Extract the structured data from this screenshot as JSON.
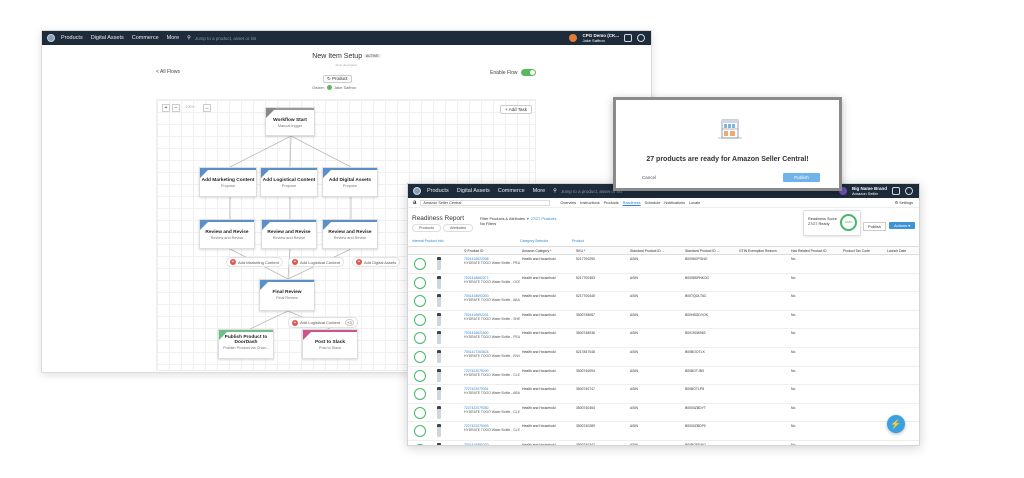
{
  "topnav": {
    "items": [
      "Products",
      "Digital Assets",
      "Commerce",
      "More"
    ],
    "search_placeholder": "Jump to a product, asset or list",
    "account_name": "CPG Demo (CK...",
    "account_user": "Jake Saffron"
  },
  "workflow": {
    "title": "New Item Setup",
    "title_badge": "ACTIVE",
    "subtitle": "Flow description",
    "back_link": "< All Flows",
    "enable_label": "Enable Flow",
    "product_label": "Product",
    "owner_label": "Owner:",
    "owner_name": "Jake Saffron",
    "add_task": "+ Add Task",
    "zoom_label": "100%",
    "nodes": [
      {
        "title": "Workflow Start",
        "sub": "Manual trigger"
      },
      {
        "title": "Add Marketing Content",
        "sub": "Propose"
      },
      {
        "title": "Add Logistical Content",
        "sub": "Propose"
      },
      {
        "title": "Add Digital Assets",
        "sub": "Propose"
      },
      {
        "title": "Review and Revise",
        "sub": "Review and Revise"
      },
      {
        "title": "Review and Revise",
        "sub": "Review and Revise"
      },
      {
        "title": "Review and Revise",
        "sub": "Review and Revise"
      },
      {
        "title": "Final Review",
        "sub": "Final Review"
      },
      {
        "title": "Publish Product to DoorDash",
        "sub": "Publish Product via Chan..."
      },
      {
        "title": "Post to Slack",
        "sub": "Post to Slack"
      }
    ],
    "add_pills": [
      "Add Marketing Content",
      "Add Logistical Content",
      "Add Digital Assets",
      "Add Logistical Content"
    ],
    "pill_count": "+3"
  },
  "modal": {
    "title": "27 products are ready for Amazon Seller Central!",
    "cancel": "Cancel",
    "publish": "Publish"
  },
  "report": {
    "topnav_items": [
      "Products",
      "Digital Assets",
      "Commerce",
      "More"
    ],
    "search_placeholder": "Jump to a product, asset or list",
    "brand": "Big Name Brand",
    "brand_sub": "Amazon Seller",
    "store": "Amazon Seller Central",
    "tabs": [
      "Overview",
      "Instructions",
      "Products",
      "Readiness",
      "Schedule",
      "Notifications",
      "Locale"
    ],
    "active_tab": "Readiness",
    "settings": "Settings",
    "title": "Readiness Report",
    "filter_label": "Filter Products & Attributes",
    "filter_link": "27/27 Products",
    "filter_none": "No Filters",
    "subtabs": [
      "Products",
      "Attributes"
    ],
    "score_label": "Readiness Score",
    "score_value": "27/27 Ready",
    "score_ring": "100%",
    "publish_btn": "Publish",
    "actions_btn": "Actions",
    "groups": [
      "Internal Product Info",
      "Category Selector",
      "Product"
    ],
    "columns": [
      "",
      "",
      "Product ID",
      "Amazon Category *",
      "SKU *",
      "Standard Product ID ...",
      "Standard Product ID ...",
      "GTIN Exemption Reason",
      "Has Related Product ID",
      "Product Tax Code",
      "Launch Date"
    ],
    "rows": [
      {
        "id": "7001416623308",
        "desc": "HYDRATE TOGO Water Bottle - PEARL WHITE 500ml, Bamboo...",
        "cat": "Health and Household",
        "sku": "5217700290",
        "std": "ASIN",
        "asin": "B0098OPGNO",
        "rel": "No"
      },
      {
        "id": "7001418682372",
        "desc": "HYDRATE TOGO Water Bottle - OCEAN BLUE 500ml, Bamboo...",
        "cat": "Health and Household",
        "sku": "5217700353",
        "std": "ASIN",
        "asin": "B0098SPNKOC",
        "rel": "No"
      },
      {
        "id": "7001418693300",
        "desc": "HYDRATE TOGO Water Bottle - ABALONE GRAY 500ml, Bam...",
        "cat": "Health and Household",
        "sku": "5217700445",
        "std": "ASIN",
        "asin": "B00TQOLT6C",
        "rel": "No"
      },
      {
        "id": "7001416692201",
        "desc": "HYDRATE TOGO Water Bottle - SHELL PINK 500ml Bamboo",
        "cat": "Health and Household",
        "sku": "3500748087",
        "std": "ASIN",
        "asin": "B00HBGDYOK",
        "rel": "No"
      },
      {
        "id": "7001416621500",
        "desc": "HYDRATE TOGO Water Bottle - PEARL WHITE 750ml, Bamboo...",
        "cat": "Health and Household",
        "sku": "3500748036",
        "std": "ASIN",
        "asin": "B00190W063",
        "rel": "No"
      },
      {
        "id": "7001417263624",
        "desc": "HYDRATE TOGO Water Bottle - ENVY SEA BLUE 750ml, Bam...",
        "cat": "Health and Household",
        "sku": "5217847048",
        "std": "ASIN",
        "asin": "B00BOOTLX",
        "rel": "No"
      },
      {
        "id": "7227422079200",
        "desc": "HYDRATE TOGO Water Bottle - CLEAR 500ml, Plastic Screw...",
        "cat": "Health and Household",
        "sku": "3500740094",
        "std": "ASIN",
        "asin": "B00BOTJB3",
        "rel": "No"
      },
      {
        "id": "7227422079301",
        "desc": "HYDRATE TOGO Water Bottle - ABALONE GRAY 750ml, Bam...",
        "cat": "Health and Household",
        "sku": "3500740747",
        "std": "ASIN",
        "asin": "B00BOTLP8",
        "rel": "No"
      },
      {
        "id": "7227422079352",
        "desc": "HYDRATE TOGO Water Bottle - CLEAR 750ml, Plastic Screw To...",
        "cat": "Health and Household",
        "sku": "3500740454",
        "std": "ASIN",
        "asin": "B0000ZBDYT",
        "rel": "No"
      },
      {
        "id": "7227422079403",
        "desc": "HYDRATE TOGO Water Bottle - CLEAR 750ml, Plastic Screw...",
        "cat": "Health and Household",
        "sku": "3500740289",
        "std": "ASIN",
        "asin": "B0000ZBDP0",
        "rel": "No"
      },
      {
        "id": "7001416880230",
        "desc": "HYDRATE TOGO Water Bottle - CLEAR 750ml, Plastic Screw...",
        "cat": "Health and Household",
        "sku": "3500740347",
        "std": "ASIN",
        "asin": "B00BO9D4IQ",
        "rel": "No"
      }
    ]
  },
  "colors": {
    "nav_bg": "#1d2b3a",
    "accent": "#2d86d1",
    "ready": "#45b867",
    "toggle": "#5cb85c"
  }
}
